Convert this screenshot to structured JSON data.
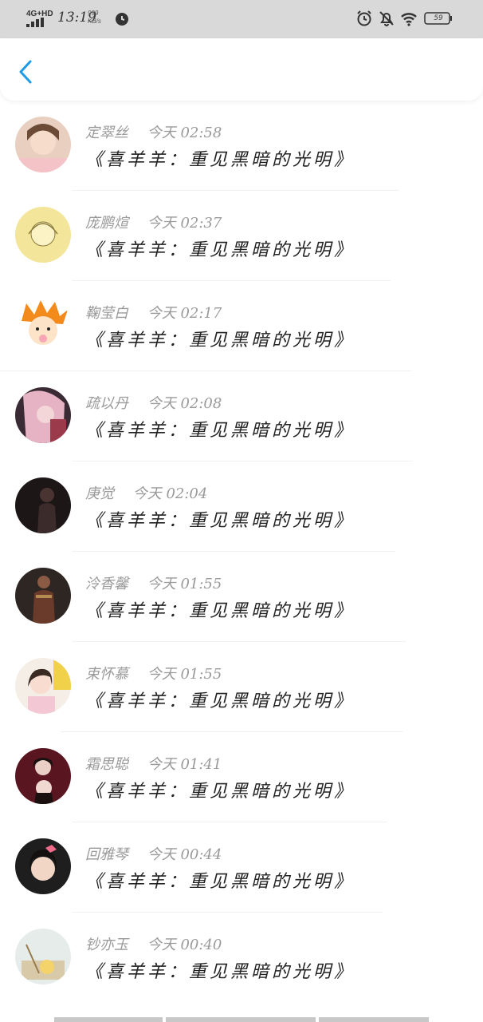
{
  "status_bar": {
    "network": "4G+HD",
    "time": "13:19",
    "speed_value": "999",
    "speed_unit": "KB/s",
    "battery": "59"
  },
  "colors": {
    "accent": "#1e9be6",
    "status_bar_bg": "#d9d9d9",
    "meta_text": "#9a9a9a",
    "title_text": "#222222"
  },
  "icons": {
    "back": "chevron-left-icon",
    "alarm": "alarm-clock-icon",
    "mute": "bell-off-icon",
    "wifi": "wifi-icon",
    "battery": "battery-icon"
  },
  "items": [
    {
      "name": "定翠丝",
      "time": "今天 02:58",
      "title": "《喜羊羊：重见黑暗的光明》"
    },
    {
      "name": "庞鹏煊",
      "time": "今天 02:37",
      "title": "《喜羊羊：重见黑暗的光明》"
    },
    {
      "name": "鞠莹白",
      "time": "今天 02:17",
      "title": "《喜羊羊：重见黑暗的光明》"
    },
    {
      "name": "疏以丹",
      "time": "今天 02:08",
      "title": "《喜羊羊：重见黑暗的光明》"
    },
    {
      "name": "庚觉",
      "time": "今天 02:04",
      "title": "《喜羊羊：重见黑暗的光明》"
    },
    {
      "name": "泠香馨",
      "time": "今天 01:55",
      "title": "《喜羊羊：重见黑暗的光明》"
    },
    {
      "name": "束怀慕",
      "time": "今天 01:55",
      "title": "《喜羊羊：重见黑暗的光明》"
    },
    {
      "name": "霜思聪",
      "time": "今天 01:41",
      "title": "《喜羊羊：重见黑暗的光明》"
    },
    {
      "name": "回雅琴",
      "time": "今天 00:44",
      "title": "《喜羊羊：重见黑暗的光明》"
    },
    {
      "name": "钞亦玉",
      "time": "今天 00:40",
      "title": "《喜羊羊：重见黑暗的光明》"
    }
  ]
}
